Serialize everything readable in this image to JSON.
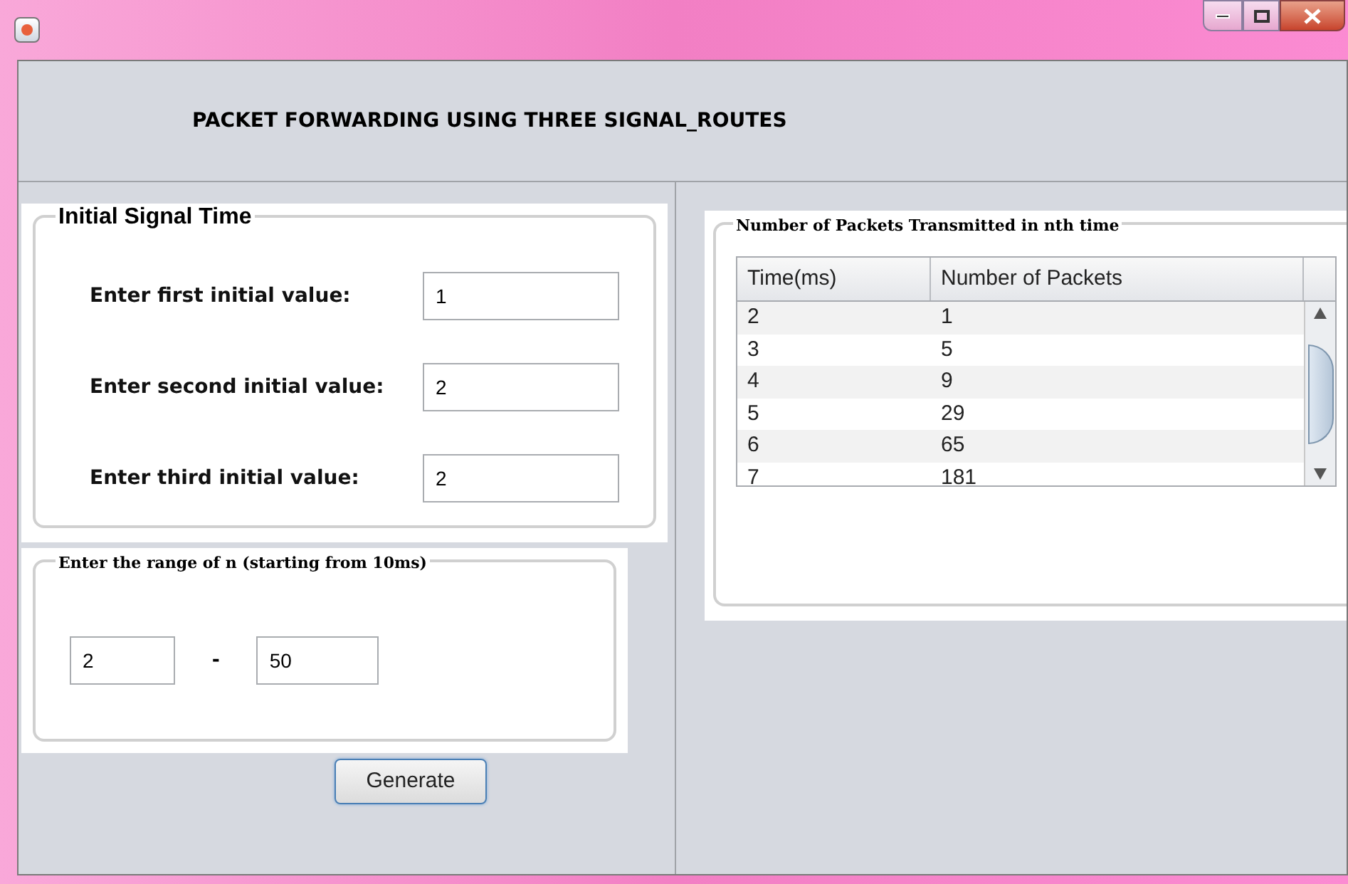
{
  "header": {
    "title": "PACKET FORWARDING USING THREE SIGNAL_ROUTES"
  },
  "initial_group": {
    "title": "Initial Signal Time",
    "fields": [
      {
        "label": "Enter first initial value:",
        "value": "1"
      },
      {
        "label": "Enter second initial value:",
        "value": "2"
      },
      {
        "label": "Enter third initial value:",
        "value": "2"
      }
    ]
  },
  "range_group": {
    "title": "Enter the range of n (starting from 10ms)",
    "from": "2",
    "separator": "-",
    "to": "50"
  },
  "generate_button": "Generate",
  "results_group": {
    "title": "Number of Packets Transmitted in nth time",
    "table": {
      "columns": [
        "Time(ms)",
        "Number of Packets"
      ],
      "rows": [
        [
          "2",
          "1"
        ],
        [
          "3",
          "5"
        ],
        [
          "4",
          "9"
        ],
        [
          "5",
          "29"
        ],
        [
          "6",
          "65"
        ],
        [
          "7",
          "181"
        ]
      ]
    }
  }
}
